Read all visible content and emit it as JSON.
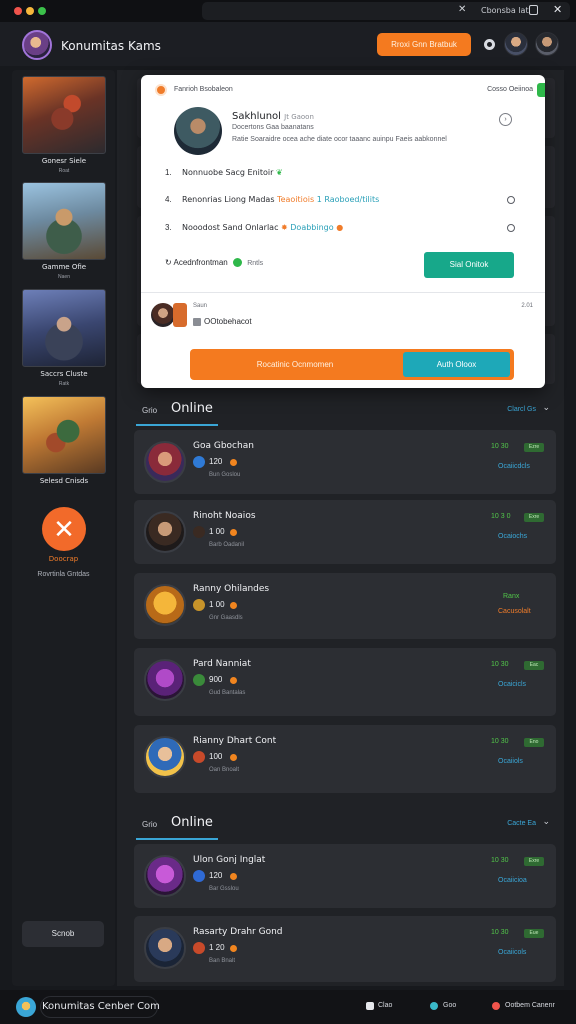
{
  "titlebar": {
    "label": "Cbonsba lat"
  },
  "header": {
    "app_title": "Konumitas Kams",
    "action_button": "Rroxi Gnn Bratbuk"
  },
  "sidebar": {
    "cards": [
      {
        "name": "Gonesr Siele",
        "sub": "Roat"
      },
      {
        "name": "Gamme Ofie",
        "sub": "Naen"
      },
      {
        "name": "Saccrs Cluste",
        "sub": "Ratk"
      },
      {
        "name": "Selesd Cnisds",
        "sub": ""
      }
    ],
    "brand": "Doocrap",
    "brand_sub": "Rovrtinla Gntdas",
    "search_button": "Scnob"
  },
  "popup": {
    "top_left": "Fanrioh Bsobaleon",
    "top_right": "Cosso Oeiinoa",
    "name": "Sakhlunol",
    "name_suffix": "Jt Gaoon",
    "line2": "Docertons Gaa baanatans",
    "line3": "Ratie Soaraidre ocea ache diate ocor taaanc auinpu Faeis aabkonnel",
    "rows": [
      {
        "num": "1.",
        "text": "Nonnuobe Sacg Enitoir",
        "extra_orange": "",
        "extra_teal": ""
      },
      {
        "num": "4.",
        "text": "Renonrias Liong Madas",
        "extra_orange": "Teaoitiois",
        "extra_teal": "1  Raoboed/tilits"
      },
      {
        "num": "3.",
        "text": "Nooodost Sand Onlarlac",
        "extra_orange": "",
        "extra_teal": "Doabbingo"
      }
    ],
    "accent_text": "Acednfrontman",
    "accent_sub": "Rntls",
    "teal_button": "Sial Onitok",
    "bottom_label": "Saun",
    "bottom_right": "2.01",
    "bottom_name": "OOtobehacot",
    "orange_bar_label": "Rocatinic Ocnmomen",
    "inner_button": "Auth Oloox"
  },
  "sections": [
    {
      "small": "Grio",
      "title": "Online",
      "right": "Clarcl Gs"
    },
    {
      "small": "Grio",
      "title": "Online",
      "right": "Cacte Ea"
    }
  ],
  "friends": [
    {
      "name": "Goa Gbochan",
      "level": "120",
      "sub": "Bun Goslou",
      "time": "10 30",
      "tag": "Ezre",
      "status": "Ocaiicdcls"
    },
    {
      "name": "Rinoht Noaios",
      "level": "1 00",
      "sub": "Barb Oadanil",
      "time": "10 3 0",
      "tag": "Exre",
      "status": "Ocaiochs"
    },
    {
      "name": "Ranny Ohilandes",
      "level": "1 00",
      "sub": "Gnr Gaasdls",
      "time": "Ranx",
      "tag": "",
      "status": "Cacusolalt"
    },
    {
      "name": "Pard Nanniat",
      "level": "900",
      "sub": "Gud Bantalas",
      "time": "10 30",
      "tag": "Eac",
      "status": "Ocaicicls"
    },
    {
      "name": "Rianny Dhart Cont",
      "level": "100",
      "sub": "Oan Bnoalt",
      "time": "10 30",
      "tag": "Eno",
      "status": "Ocaiiols"
    },
    {
      "name": "Ulon Gonj Inglat",
      "level": "120",
      "sub": "Bar Gsslou",
      "time": "10 30",
      "tag": "Exre",
      "status": "Ocaiicioa"
    },
    {
      "name": "Rasarty Drahr Gond",
      "level": "1 20",
      "sub": "Ban Bnalt",
      "time": "10 30",
      "tag": "Eue",
      "status": "Ocaiicols"
    }
  ],
  "bottombar": {
    "title": "Konumitas Cenber Com",
    "items": [
      "Clao",
      "Goo",
      "Ootbem Canenr"
    ]
  },
  "colors": {
    "accent_orange": "#f47a1f",
    "accent_teal": "#1ea8b8",
    "online_green": "#52c64a",
    "link_blue": "#3aa6d6"
  }
}
